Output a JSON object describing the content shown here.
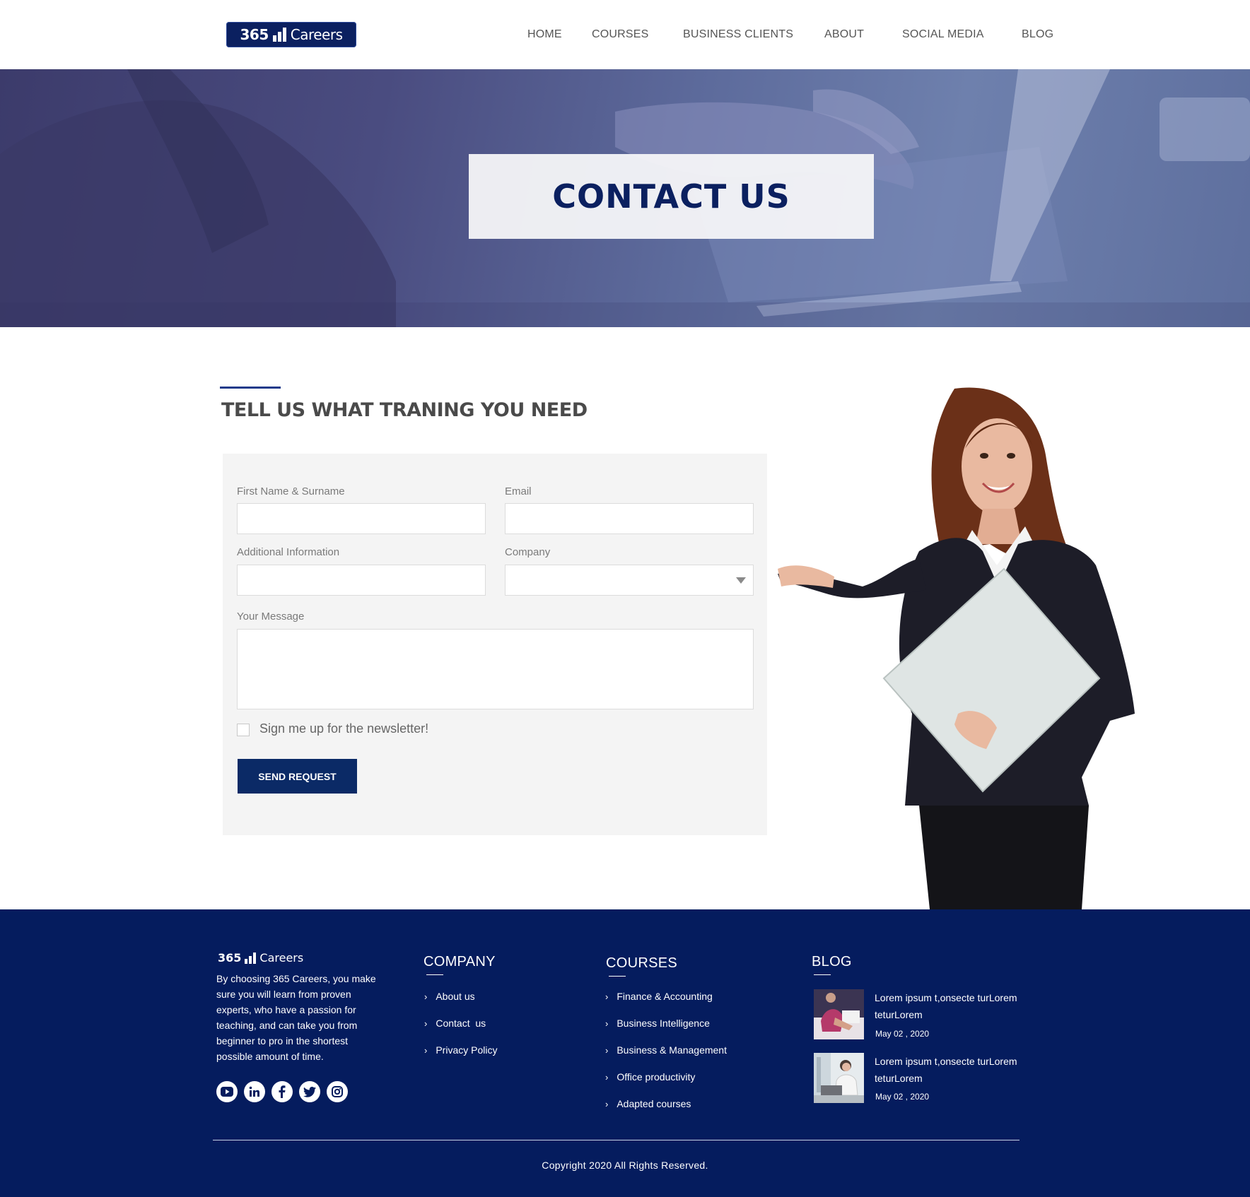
{
  "brand": {
    "logo_number": "365",
    "logo_word": "Careers"
  },
  "nav": {
    "items": [
      {
        "label": "HOME"
      },
      {
        "label": "COURSES"
      },
      {
        "label": "BUSINESS CLIENTS"
      },
      {
        "label": "ABOUT"
      },
      {
        "label": "SOCIAL MEDIA"
      },
      {
        "label": "BLOG"
      }
    ]
  },
  "hero": {
    "title": "CONTACT US"
  },
  "section": {
    "title": "TELL US WHAT TRANING YOU NEED"
  },
  "form": {
    "name_label": "First Name & Surname",
    "name_value": "",
    "email_label": "Email",
    "email_value": "",
    "additional_label": "Additional Information",
    "additional_value": "",
    "company_label": "Company",
    "company_value": "",
    "message_label": "Your Message",
    "message_value": "",
    "newsletter_label": "Sign me up for the newsletter!",
    "newsletter_checked": false,
    "submit_label": "SEND REQUEST"
  },
  "footer": {
    "about": "By choosing 365 Careers, you make sure you will learn from proven experts, who have a passion for teaching, and can take you from beginner to pro in the shortest possible amount of time.",
    "social_icons": [
      "youtube-icon",
      "linkedin-icon",
      "facebook-icon",
      "twitter-icon",
      "instagram-icon"
    ],
    "company": {
      "heading": "COMPANY",
      "links": [
        "About us",
        "Contact  us",
        "Privacy Policy"
      ]
    },
    "courses": {
      "heading": "COURSES",
      "links": [
        "Finance & Accounting",
        "Business Intelligence",
        "Business & Management",
        "Office productivity",
        "Adapted courses"
      ]
    },
    "blog": {
      "heading": "BLOG",
      "posts": [
        {
          "title": "Lorem ipsum t,onsecte turLorem teturLorem",
          "date": "May 02 , 2020"
        },
        {
          "title": "Lorem ipsum t,onsecte turLorem teturLorem",
          "date": "May 02 , 2020"
        }
      ]
    },
    "copyright": "Copyright 2020 All Rights Reserved."
  },
  "colors": {
    "brand_navy": "#0b2060",
    "footer_bg": "#051c5e",
    "button_bg": "#0b2a66",
    "accent": "#1e3a8a"
  }
}
